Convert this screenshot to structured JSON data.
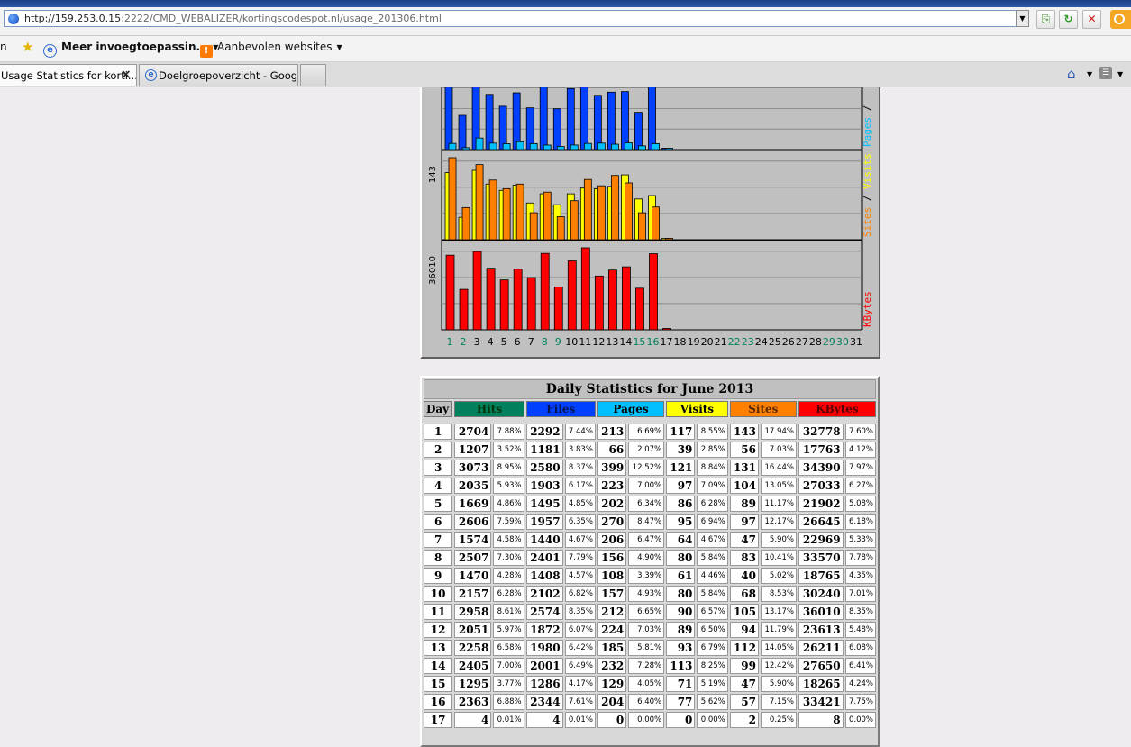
{
  "browser": {
    "url_host": "http://159.253.0.15",
    "url_rest": ":2222/CMD_WEBALIZER/kortingscodespot.nl/usage_201306.html",
    "favorites_stub": "n",
    "favorites": [
      {
        "label": "Meer invoegtoepassin..."
      },
      {
        "label": "Aanbevolen websites"
      }
    ],
    "tabs": [
      {
        "label": "Usage Statistics for korti..."
      },
      {
        "label": "Doelgroepoverzicht - Google..."
      }
    ]
  },
  "colors": {
    "hits": "#00805c",
    "files": "#0040ff",
    "pages": "#00c0ff",
    "visits": "#ffff00",
    "sites": "#ff8000",
    "kbytes": "#ff0000",
    "panel": "#c0c0c0"
  },
  "chart_data": {
    "type": "bar",
    "x_days": [
      1,
      2,
      3,
      4,
      5,
      6,
      7,
      8,
      9,
      10,
      11,
      12,
      13,
      14,
      15,
      16,
      17,
      18,
      19,
      20,
      21,
      22,
      23,
      24,
      25,
      26,
      27,
      28,
      29,
      30,
      31
    ],
    "weekend_days": [
      1,
      2,
      8,
      9,
      15,
      16,
      22,
      23,
      29,
      30
    ],
    "panels": [
      {
        "name": "pages",
        "legend": [
          "Pages",
          "/"
        ],
        "ymax_label": "",
        "series": [
          {
            "name": "Files",
            "color": "#0040ff",
            "values": [
              2292,
              1181,
              2580,
              1903,
              1495,
              1957,
              1440,
              2401,
              1408,
              2102,
              2574,
              1872,
              1980,
              2001,
              1286,
              2344,
              4
            ]
          },
          {
            "name": "Pages",
            "color": "#00c0ff",
            "values": [
              213,
              66,
              399,
              223,
              202,
              270,
              206,
              156,
              108,
              157,
              212,
              224,
              185,
              232,
              129,
              204,
              0
            ]
          }
        ]
      },
      {
        "name": "sites_visits",
        "legend": [
          "Sites",
          "/",
          "Visits"
        ],
        "ymax_label": "143",
        "series": [
          {
            "name": "Visits",
            "color": "#ffff00",
            "values": [
              117,
              39,
              121,
              97,
              86,
              95,
              64,
              80,
              61,
              80,
              90,
              89,
              93,
              113,
              71,
              77,
              0
            ]
          },
          {
            "name": "Sites",
            "color": "#ff8000",
            "values": [
              143,
              56,
              131,
              104,
              89,
              97,
              47,
              83,
              40,
              68,
              105,
              94,
              112,
              99,
              47,
              57,
              2
            ]
          }
        ]
      },
      {
        "name": "kbytes",
        "legend": [
          "KBytes"
        ],
        "ymax_label": "36010",
        "series": [
          {
            "name": "KBytes",
            "color": "#ff0000",
            "values": [
              32778,
              17763,
              34390,
              27033,
              21902,
              26645,
              22969,
              33570,
              18765,
              30240,
              36010,
              23613,
              26211,
              27650,
              18265,
              33421,
              8
            ]
          }
        ]
      }
    ]
  },
  "daily": {
    "title": "Daily Statistics for June 2013",
    "headers": [
      "Day",
      "Hits",
      "Files",
      "Pages",
      "Visits",
      "Sites",
      "KBytes"
    ],
    "rows": [
      [
        "1",
        "2704",
        "7.88%",
        "2292",
        "7.44%",
        "213",
        "6.69%",
        "117",
        "8.55%",
        "143",
        "17.94%",
        "32778",
        "7.60%"
      ],
      [
        "2",
        "1207",
        "3.52%",
        "1181",
        "3.83%",
        "66",
        "2.07%",
        "39",
        "2.85%",
        "56",
        "7.03%",
        "17763",
        "4.12%"
      ],
      [
        "3",
        "3073",
        "8.95%",
        "2580",
        "8.37%",
        "399",
        "12.52%",
        "121",
        "8.84%",
        "131",
        "16.44%",
        "34390",
        "7.97%"
      ],
      [
        "4",
        "2035",
        "5.93%",
        "1903",
        "6.17%",
        "223",
        "7.00%",
        "97",
        "7.09%",
        "104",
        "13.05%",
        "27033",
        "6.27%"
      ],
      [
        "5",
        "1669",
        "4.86%",
        "1495",
        "4.85%",
        "202",
        "6.34%",
        "86",
        "6.28%",
        "89",
        "11.17%",
        "21902",
        "5.08%"
      ],
      [
        "6",
        "2606",
        "7.59%",
        "1957",
        "6.35%",
        "270",
        "8.47%",
        "95",
        "6.94%",
        "97",
        "12.17%",
        "26645",
        "6.18%"
      ],
      [
        "7",
        "1574",
        "4.58%",
        "1440",
        "4.67%",
        "206",
        "6.47%",
        "64",
        "4.67%",
        "47",
        "5.90%",
        "22969",
        "5.33%"
      ],
      [
        "8",
        "2507",
        "7.30%",
        "2401",
        "7.79%",
        "156",
        "4.90%",
        "80",
        "5.84%",
        "83",
        "10.41%",
        "33570",
        "7.78%"
      ],
      [
        "9",
        "1470",
        "4.28%",
        "1408",
        "4.57%",
        "108",
        "3.39%",
        "61",
        "4.46%",
        "40",
        "5.02%",
        "18765",
        "4.35%"
      ],
      [
        "10",
        "2157",
        "6.28%",
        "2102",
        "6.82%",
        "157",
        "4.93%",
        "80",
        "5.84%",
        "68",
        "8.53%",
        "30240",
        "7.01%"
      ],
      [
        "11",
        "2958",
        "8.61%",
        "2574",
        "8.35%",
        "212",
        "6.65%",
        "90",
        "6.57%",
        "105",
        "13.17%",
        "36010",
        "8.35%"
      ],
      [
        "12",
        "2051",
        "5.97%",
        "1872",
        "6.07%",
        "224",
        "7.03%",
        "89",
        "6.50%",
        "94",
        "11.79%",
        "23613",
        "5.48%"
      ],
      [
        "13",
        "2258",
        "6.58%",
        "1980",
        "6.42%",
        "185",
        "5.81%",
        "93",
        "6.79%",
        "112",
        "14.05%",
        "26211",
        "6.08%"
      ],
      [
        "14",
        "2405",
        "7.00%",
        "2001",
        "6.49%",
        "232",
        "7.28%",
        "113",
        "8.25%",
        "99",
        "12.42%",
        "27650",
        "6.41%"
      ],
      [
        "15",
        "1295",
        "3.77%",
        "1286",
        "4.17%",
        "129",
        "4.05%",
        "71",
        "5.19%",
        "47",
        "5.90%",
        "18265",
        "4.24%"
      ],
      [
        "16",
        "2363",
        "6.88%",
        "2344",
        "7.61%",
        "204",
        "6.40%",
        "77",
        "5.62%",
        "57",
        "7.15%",
        "33421",
        "7.75%"
      ],
      [
        "17",
        "4",
        "0.01%",
        "4",
        "0.01%",
        "0",
        "0.00%",
        "0",
        "0.00%",
        "2",
        "0.25%",
        "8",
        "0.00%"
      ]
    ]
  }
}
